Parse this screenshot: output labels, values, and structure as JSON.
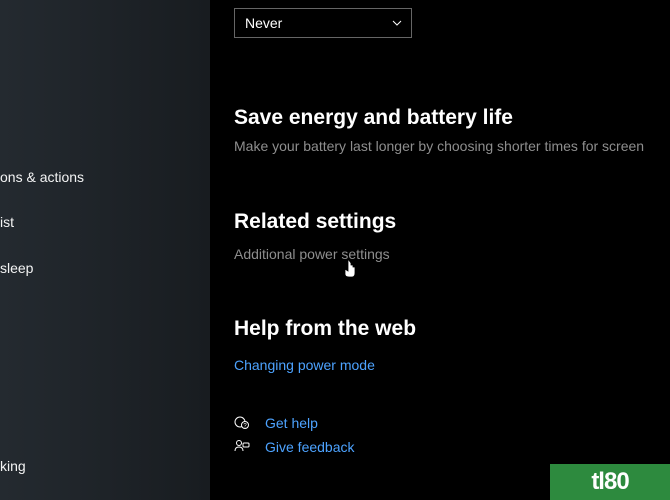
{
  "sidebar": {
    "items": [
      {
        "label": "ons & actions"
      },
      {
        "label": "ist"
      },
      {
        "label": "sleep"
      },
      {
        "label": "king"
      }
    ]
  },
  "dropdown": {
    "value": "Never"
  },
  "energy": {
    "heading": "Save energy and battery life",
    "description": "Make your battery last longer by choosing shorter times for screen"
  },
  "related": {
    "heading": "Related settings",
    "link": "Additional power settings"
  },
  "helpweb": {
    "heading": "Help from the web",
    "link": "Changing power mode"
  },
  "help": {
    "getHelp": "Get help",
    "feedback": "Give feedback"
  },
  "watermark": "tl80"
}
